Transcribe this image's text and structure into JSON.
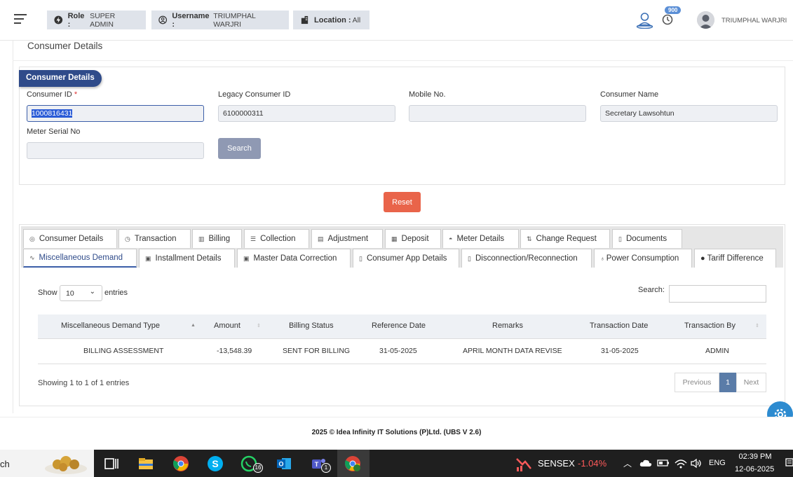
{
  "header": {
    "role_label": "Role :",
    "role_value": "SUPER ADMIN",
    "username_label": "Username :",
    "username_value": "TRIUMPHAL WARJRI",
    "location_label": "Location :",
    "location_value": "All",
    "notification_count": "900",
    "user_display": "TRIUMPHAL WARJRI"
  },
  "page": {
    "title": "Consumer Details"
  },
  "form": {
    "section_tag": "Consumer Details",
    "consumer_id_label": "Consumer ID",
    "required_mark": "*",
    "consumer_id_value": "1000816431",
    "legacy_id_label": "Legacy Consumer ID",
    "legacy_id_value": "6100000311",
    "mobile_label": "Mobile No.",
    "mobile_value": "",
    "name_label": "Consumer Name",
    "name_value": "Secretary  Lawsohtun",
    "meter_serial_label": "Meter Serial No",
    "meter_serial_value": "",
    "search_button": "Search",
    "reset_button": "Reset"
  },
  "tabs": {
    "row1": [
      {
        "label": "Consumer Details",
        "icon": "target-icon"
      },
      {
        "label": "Transaction",
        "icon": "clock-icon"
      },
      {
        "label": "Billing",
        "icon": "chart-icon"
      },
      {
        "label": "Collection",
        "icon": "list-icon"
      },
      {
        "label": "Adjustment",
        "icon": "file-icon"
      },
      {
        "label": "Deposit",
        "icon": "bank-icon"
      },
      {
        "label": "Meter Details",
        "icon": "gauge-icon"
      },
      {
        "label": "Change Request",
        "icon": "swap-icon"
      },
      {
        "label": "Documents",
        "icon": "document-icon"
      }
    ],
    "row2": [
      {
        "label": "Miscellaneous Demand",
        "icon": "pulse-icon",
        "active": true
      },
      {
        "label": "Installment Details",
        "icon": "calculator-icon"
      },
      {
        "label": "Master Data Correction",
        "icon": "calculator-icon"
      },
      {
        "label": "Consumer App Details",
        "icon": "mobile-icon"
      },
      {
        "label": "Disconnection/Reconnection",
        "icon": "mobile-icon"
      },
      {
        "label": "Power Consumption",
        "icon": "bulb-icon"
      },
      {
        "label": "Tariff Difference",
        "icon": "circle-icon"
      }
    ]
  },
  "table": {
    "show_label": "Show",
    "page_size": "10",
    "entries_label": "entries",
    "search_label": "Search:",
    "search_value": "",
    "columns": [
      "Miscellaneous Demand Type",
      "Amount",
      "Billing Status",
      "Reference Date",
      "Remarks",
      "Transaction Date",
      "Transaction By"
    ],
    "rows": [
      [
        "BILLING ASSESSMENT",
        "-13,548.39",
        "SENT FOR BILLING",
        "31-05-2025",
        "APRIL MONTH DATA REVISE",
        "31-05-2025",
        "ADMIN"
      ]
    ],
    "showing_text": "Showing 1 to 1 of 1 entries",
    "prev_label": "Previous",
    "current_page": "1",
    "next_label": "Next"
  },
  "footer": {
    "text": "2025 © Idea Infinity IT Solutions (P)Ltd. (UBS V 2.6)"
  },
  "taskbar": {
    "search_fragment": "ch",
    "whatsapp_badge": "16",
    "teams_badge": "1",
    "ticker_name": "SENSEX",
    "ticker_value": "-1.04%",
    "language": "ENG",
    "time": "02:39 PM",
    "date": "12-06-2025"
  }
}
